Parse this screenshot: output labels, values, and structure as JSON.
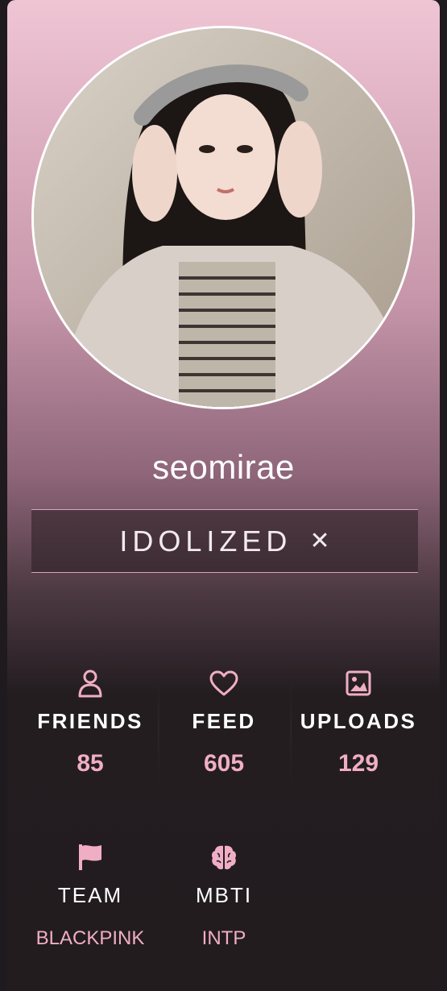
{
  "profile": {
    "username": "seomirae",
    "status_label": "IDOLIZED",
    "status_close": "✕"
  },
  "stats": [
    {
      "icon": "user-icon",
      "label": "FRIENDS",
      "value": "85"
    },
    {
      "icon": "heart-icon",
      "label": "FEED",
      "value": "605"
    },
    {
      "icon": "image-icon",
      "label": "UPLOADS",
      "value": "129"
    }
  ],
  "info": [
    {
      "icon": "flag-icon",
      "label": "TEAM",
      "value": "BLACKPINK"
    },
    {
      "icon": "brain-icon",
      "label": "MBTI",
      "value": "INTP"
    }
  ],
  "colors": {
    "accent": "#f0aec4",
    "background": "#1f1a1d",
    "gradient_top": "#efc5d4"
  }
}
